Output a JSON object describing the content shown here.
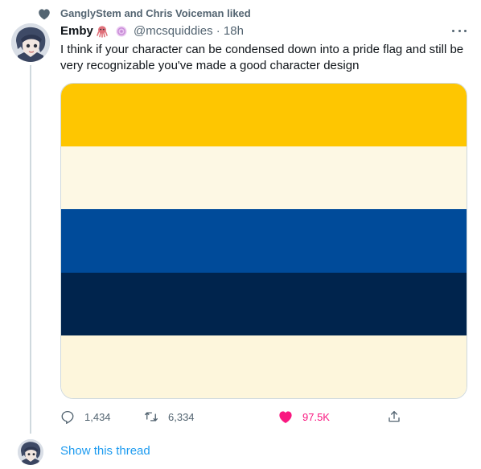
{
  "social_context": {
    "text": "GanglyStem and Chris Voiceman liked",
    "icon": "heart-icon"
  },
  "tweet": {
    "author_name": "Emby",
    "author_emojis": [
      "octopus-emoji",
      "lollipop-emoji"
    ],
    "handle_time": "@mcsquiddies · 18h",
    "more_icon": "more-dots-icon",
    "text": "I think if your character can be condensed down into a pride flag and still be very recognizable you've made a good character design",
    "media": {
      "stripes": [
        {
          "color": "#fec601"
        },
        {
          "color": "#fdf8e4"
        },
        {
          "color": "#004b9a"
        },
        {
          "color": "#00244d"
        },
        {
          "color": "#fdf6dc"
        }
      ]
    },
    "actions": {
      "reply": {
        "icon": "reply-icon",
        "count": "1,434"
      },
      "retweet": {
        "icon": "retweet-icon",
        "count": "6,334"
      },
      "like": {
        "icon": "heart-filled-icon",
        "count": "97.5K",
        "color": "#f91880"
      },
      "share": {
        "icon": "share-icon"
      }
    }
  },
  "show_thread": {
    "label": "Show this thread"
  },
  "colors": {
    "secondary_text": "#536471",
    "accent_link": "#1d9bf0",
    "like_pink": "#f91880",
    "divider": "#cfd9de"
  }
}
